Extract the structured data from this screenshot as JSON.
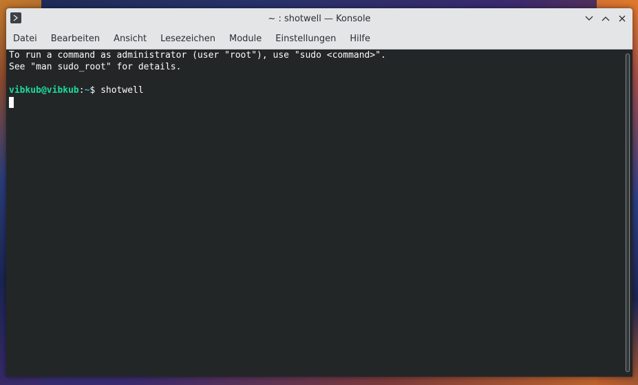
{
  "window": {
    "title": "~ : shotwell — Konsole",
    "app_icon": "terminal-icon",
    "controls": [
      "minimize-icon",
      "maximize-icon",
      "close-icon"
    ]
  },
  "menubar": {
    "items": [
      "Datei",
      "Bearbeiten",
      "Ansicht",
      "Lesezeichen",
      "Module",
      "Einstellungen",
      "Hilfe"
    ]
  },
  "terminal": {
    "line1": "To run a command as administrator (user \"root\"), use \"sudo <command>\".",
    "line2": "See \"man sudo_root\" for details.",
    "prompt_user": "vibkub@vibkub",
    "prompt_sep": ":",
    "prompt_path": "~",
    "prompt_symbol": "$ ",
    "command": "shotwell"
  },
  "colors": {
    "terminal_bg": "#232627",
    "terminal_fg": "#fcfcfc",
    "prompt_user": "#1cdc9a",
    "prompt_path": "#3daee9",
    "chrome_bg": "#e3e5e7"
  }
}
